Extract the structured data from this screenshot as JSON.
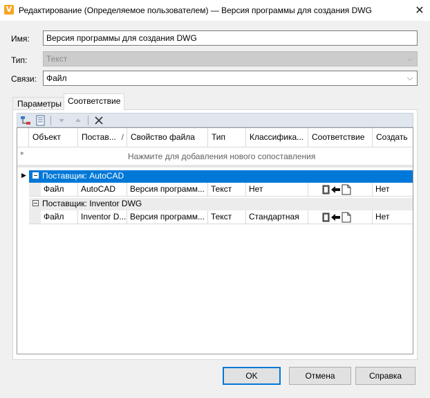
{
  "window": {
    "title": "Редактирование (Определяемое пользователем) — Версия программы для создания DWG",
    "logo_letter": "V",
    "close_glyph": "✕"
  },
  "form": {
    "name_label": "Имя:",
    "name_value": "Версия программы для создания DWG",
    "type_label": "Тип:",
    "type_value": "Текст",
    "links_label": "Связи:",
    "links_value": "Файл"
  },
  "tabs": [
    {
      "label": "Параметры"
    },
    {
      "label": "Соответствие"
    }
  ],
  "toolbar": {
    "icons": [
      "add-mapping-icon",
      "properties-icon",
      "move-down-icon",
      "move-up-icon",
      "delete-icon"
    ]
  },
  "grid": {
    "columns": [
      "Объект",
      "Постав...",
      "Свойство файла",
      "Тип",
      "Классифика...",
      "Соответствие",
      "Создать"
    ],
    "sort_indicator": "/",
    "new_row_marker": "*",
    "hint": "Нажмите для добавления нового сопоставления",
    "groups": [
      {
        "label": "Поставщик: AutoCAD",
        "selected": true,
        "row": {
          "object": "Файл",
          "provider": "AutoCAD",
          "property": "Версия программ...",
          "type": "Текст",
          "classification": "Нет",
          "create": "Нет"
        }
      },
      {
        "label": "Поставщик: Inventor DWG",
        "selected": false,
        "row": {
          "object": "Файл",
          "provider": "Inventor D...",
          "property": "Версия программ...",
          "type": "Текст",
          "classification": "Стандартная",
          "create": "Нет"
        }
      }
    ]
  },
  "buttons": {
    "ok": "OK",
    "cancel": "Отмена",
    "help": "Справка"
  },
  "colors": {
    "selection": "#0078d7",
    "accent": "#f5a623"
  }
}
